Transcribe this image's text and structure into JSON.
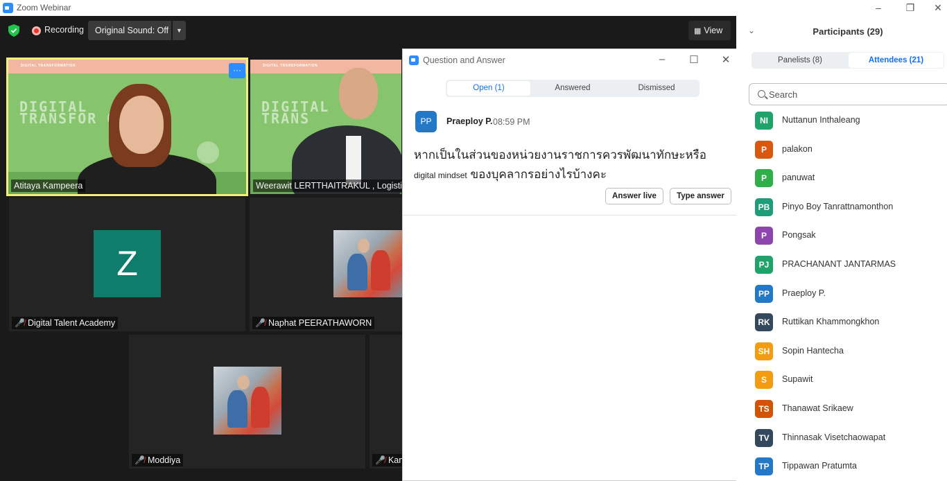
{
  "window": {
    "title": "Zoom Webinar"
  },
  "toolbar": {
    "recording_label": "Recording",
    "original_sound_label": "Original Sound: Off",
    "view_label": "View"
  },
  "videos": {
    "slide_header": "DIGITAL TRANSFORMATION",
    "slide_big_line1": "DIGITAL",
    "slide_big_line2": "TRANSFOR   ON",
    "tiles": [
      {
        "name": "Atitaya Kampeera"
      },
      {
        "name": "Weerawit LERTTHAITRAKUL , Logistic"
      },
      {
        "name": "Digital Talent Academy",
        "avatar_letter": "Z"
      },
      {
        "name": "Naphat PEERATHAWORN"
      },
      {
        "name": "Moddiya"
      },
      {
        "name": "Kan"
      }
    ]
  },
  "qa": {
    "title": "Question and Answer",
    "tabs": {
      "open": "Open (1)",
      "answered": "Answered",
      "dismissed": "Dismissed"
    },
    "question": {
      "avatar": "PP",
      "author": "Praeploy P.",
      "time": "08:59 PM",
      "line1": "หากเป็นในส่วนของหน่วยงานราชการควรพัฒนาทักษะหรือ",
      "line2_small": "digital mindset",
      "line2_rest": " ของบุคลากรอย่างไรบ้างคะ"
    },
    "buttons": {
      "answer_live": "Answer live",
      "type_answer": "Type answer"
    }
  },
  "participants": {
    "title": "Participants (29)",
    "tabs": {
      "panelists": "Panelists (8)",
      "attendees": "Attendees (21)"
    },
    "search_placeholder": "Search",
    "list": [
      {
        "initials": "NI",
        "name": "Nuttanun Inthaleang",
        "color": "#1fa36b"
      },
      {
        "initials": "P",
        "name": "palakon",
        "color": "#d9580d"
      },
      {
        "initials": "P",
        "name": "panuwat",
        "color": "#2fae4a"
      },
      {
        "initials": "PB",
        "name": "Pinyo Boy Tanrattnamonthon",
        "color": "#1e9d7a"
      },
      {
        "initials": "P",
        "name": "Pongsak",
        "color": "#8e44ad"
      },
      {
        "initials": "PJ",
        "name": "PRACHANANT JANTARMAS",
        "color": "#1fa36b"
      },
      {
        "initials": "PP",
        "name": "Praeploy P.",
        "color": "#2478c8"
      },
      {
        "initials": "RK",
        "name": "Ruttikan Khammongkhon",
        "color": "#34495e"
      },
      {
        "initials": "SH",
        "name": "Sopin Hantecha",
        "color": "#f39c12"
      },
      {
        "initials": "S",
        "name": "Supawit",
        "color": "#f39c12"
      },
      {
        "initials": "TS",
        "name": "Thanawat Srikaew",
        "color": "#d35400"
      },
      {
        "initials": "TV",
        "name": "Thinnasak Visetchaowapat",
        "color": "#34495e"
      },
      {
        "initials": "TP",
        "name": "Tippawan Pratumta",
        "color": "#2478c8"
      }
    ]
  }
}
